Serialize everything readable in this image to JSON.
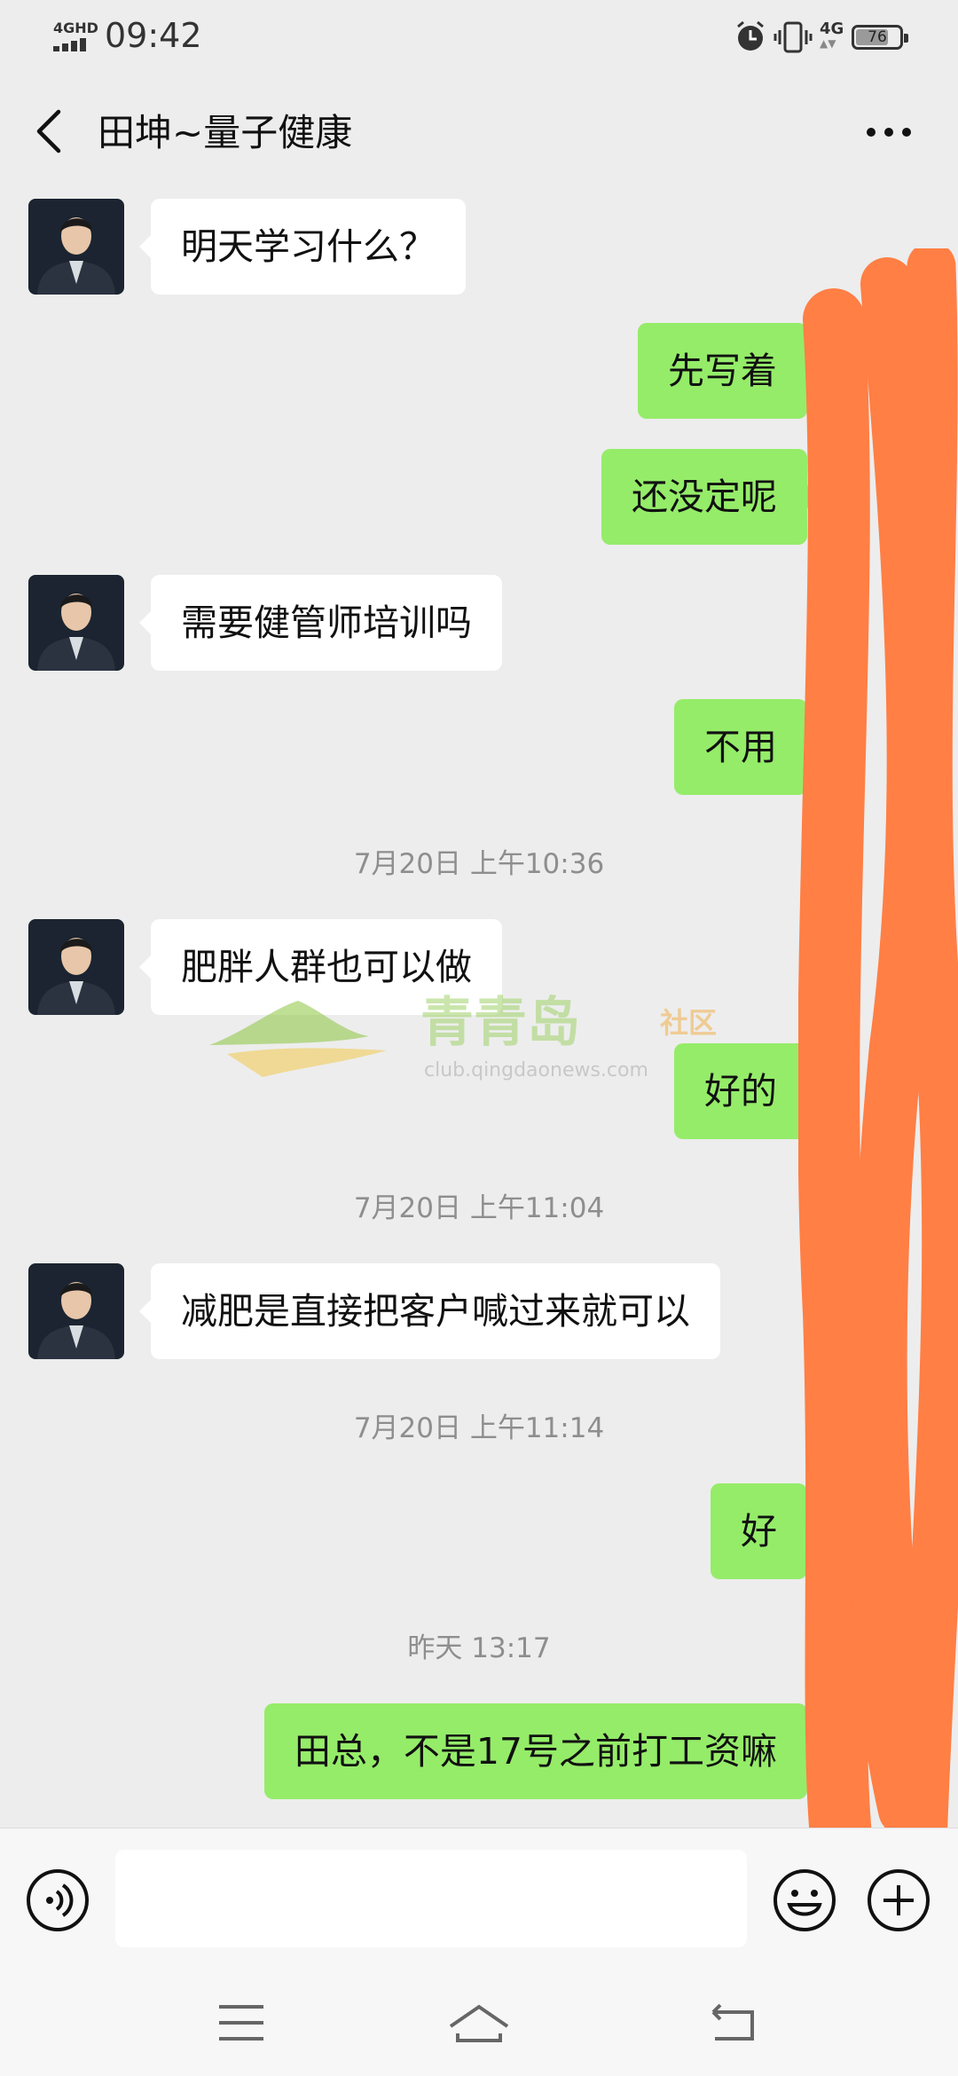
{
  "status_bar": {
    "network_label": "4GHD",
    "time": "09:42",
    "icons": [
      "alarm-icon",
      "vibrate-icon",
      "4g-icon"
    ],
    "mobile_data_label": "4G",
    "battery_level": 76,
    "battery_text": "76"
  },
  "header": {
    "title": "田坤~量子健康",
    "back_icon": "chevron-left-icon",
    "more_icon": "more-dots-icon"
  },
  "messages": [
    {
      "from": "contact",
      "text": "明天学习什么？"
    },
    {
      "from": "me",
      "text": "先写着"
    },
    {
      "from": "me",
      "text": "还没定呢"
    },
    {
      "from": "contact",
      "text": "需要健管师培训吗"
    },
    {
      "from": "me",
      "text": "不用"
    },
    {
      "type": "time",
      "text": "7月20日 上午10:36"
    },
    {
      "from": "contact",
      "text": "肥胖人群也可以做"
    },
    {
      "from": "me",
      "text": "好的"
    },
    {
      "type": "time",
      "text": "7月20日 上午11:04"
    },
    {
      "from": "contact",
      "text": "减肥是直接把客户喊过来就可以"
    },
    {
      "type": "time",
      "text": "7月20日 上午11:14"
    },
    {
      "from": "me",
      "text": "好"
    },
    {
      "type": "time",
      "text": "昨天 13:17"
    },
    {
      "from": "me",
      "text": "田总，不是17号之前打工资嘛"
    }
  ],
  "watermark": {
    "brand": "青青岛",
    "suffix": "社区",
    "url": "club.qingdaonews.com"
  },
  "input_bar": {
    "placeholder": "",
    "value": ""
  },
  "colors": {
    "background": "#ededed",
    "outgoing_bubble": "#95ec69",
    "incoming_bubble": "#ffffff",
    "timestamp_text": "#8e8e8e",
    "redaction": "#ff7f45"
  }
}
